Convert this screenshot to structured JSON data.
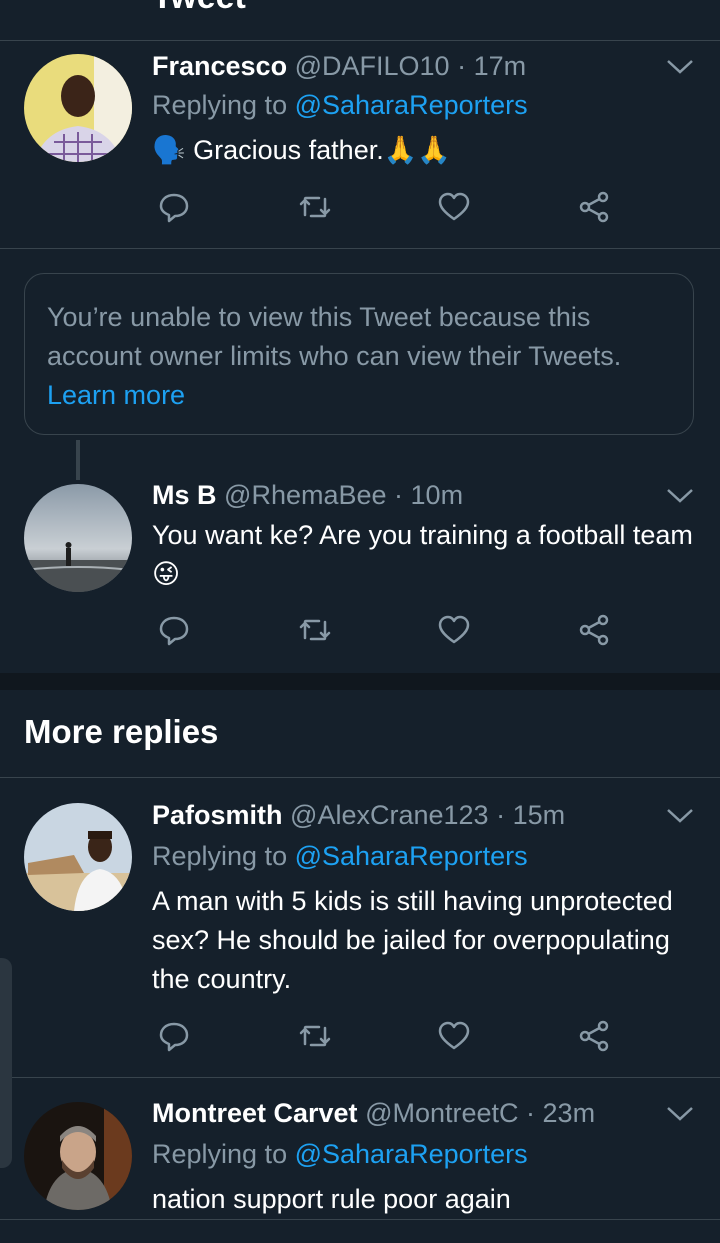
{
  "header": {
    "title": "Tweet"
  },
  "tweets": [
    {
      "name": "Francesco",
      "handle": "@DAFILO10",
      "time": "· 17m",
      "replying_prefix": "Replying to ",
      "replying_to": "@SaharaReporters",
      "text": "🗣️ Gracious father.🙏🙏"
    },
    {
      "name": "Ms B",
      "handle": "@RhemaBee",
      "time": "· 10m",
      "text": "You want ke? Are you training a football team 😜"
    },
    {
      "name": "Pafosmith",
      "handle": "@AlexCrane123",
      "time": "· 15m",
      "replying_prefix": "Replying to ",
      "replying_to": "@SaharaReporters",
      "text": "A man with 5 kids is still having unprotected sex? He should be jailed for overpopulating the country."
    },
    {
      "name": "Montreet Carvet",
      "handle": "@MontreetC",
      "time": "· 23m",
      "replying_prefix": "Replying to ",
      "replying_to": "@SaharaReporters",
      "text": "nation support rule poor again"
    }
  ],
  "limited_notice": {
    "text": "You’re unable to view this Tweet because this account owner limits who can view their Tweets. ",
    "link": "Learn more"
  },
  "section": {
    "more_replies": "More replies"
  },
  "icons": {
    "reply": "reply-icon",
    "retweet": "retweet-icon",
    "like": "heart-icon",
    "share": "share-icon",
    "menu": "chevron-down-icon"
  },
  "colors": {
    "background": "#15202b",
    "link": "#1da1f2",
    "muted": "#8899a6",
    "divider": "#38444d"
  }
}
